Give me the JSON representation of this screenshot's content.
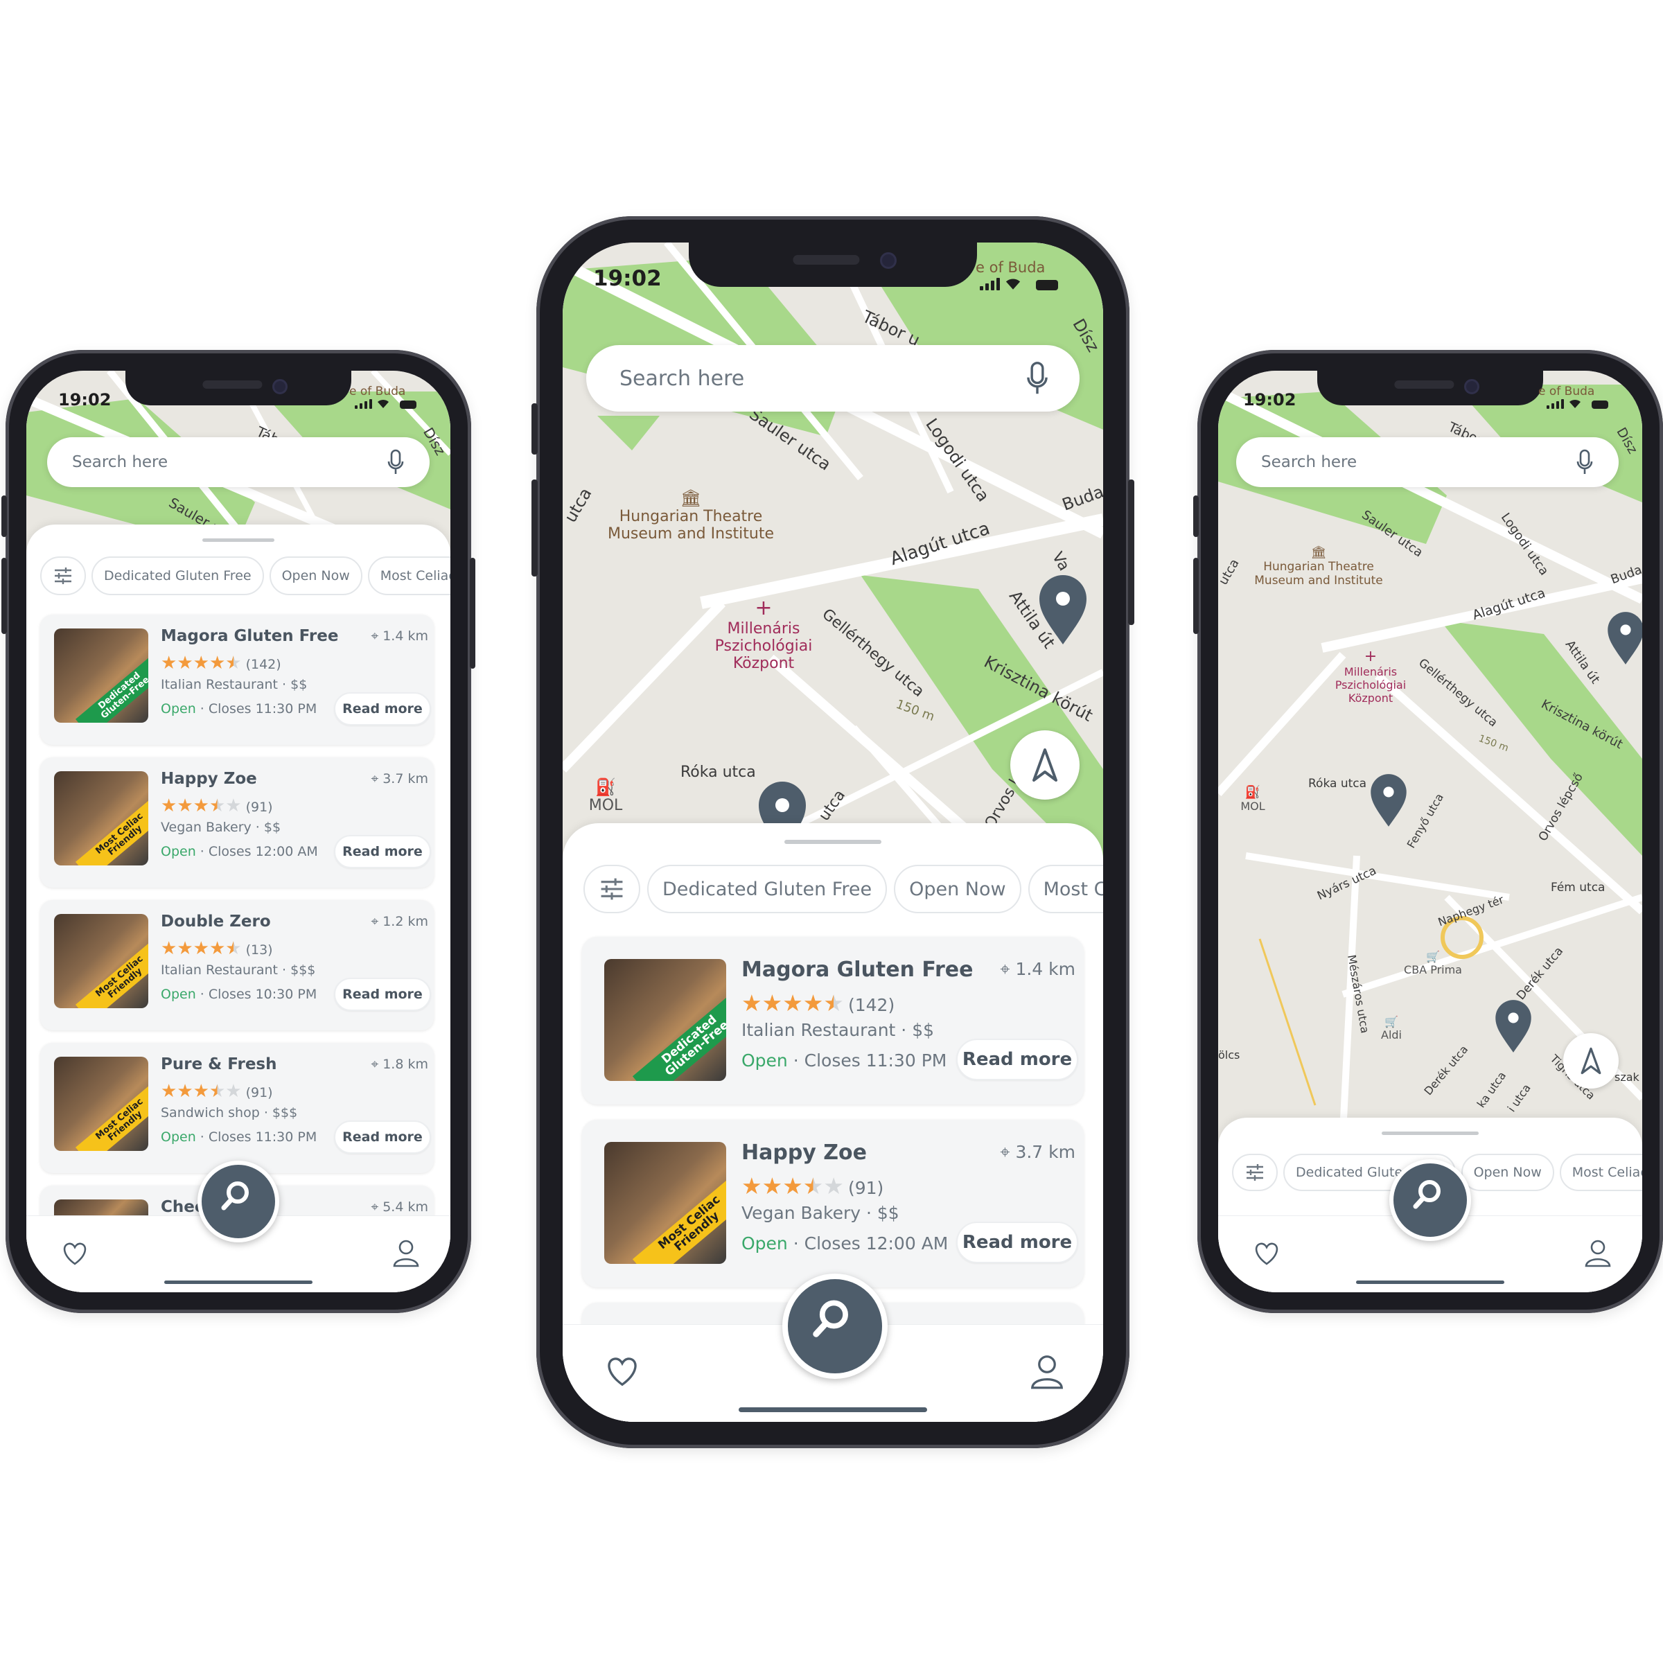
{
  "status": {
    "time": "19:02",
    "map_corner": "e of Buda"
  },
  "search": {
    "placeholder": "Search here"
  },
  "chips": {
    "dedicated": "Dedicated Gluten Free",
    "open_now": "Open Now",
    "most": "Most Celiac Friendly"
  },
  "map_labels": {
    "tabor": "Tábor u",
    "dis": "Dísz",
    "sauler": "Sauler utca",
    "logodi": "Logodi utca",
    "buda": "Buda",
    "utca_left": "utca",
    "theatre": "Hungarian Theatre\nMuseum and Institute",
    "alagut": "Alagút utca",
    "attila": "Attila út",
    "va": "Va",
    "hosp": "Millenáris\nPszichológiai\nKözpont",
    "gellert": "Gellérthegy utca",
    "krisztina": "Krisztina körút",
    "m150": "150 m",
    "mol": "MOL",
    "roka": "Róka utca",
    "orvos": "Orvos lépcső",
    "utca_pin": "utca",
    "fenyo": "Fenyő utca",
    "nyars": "Nyárs utca",
    "naphegy": "Naphegy tér",
    "fem": "Fém utca",
    "cba": "CBA Prima",
    "meszaros": "Mészáros utca",
    "derek": "Derék utca",
    "aldi": "Aldi",
    "tigris": "Tigris utca",
    "szak": "szak",
    "bolcs": "ölcs",
    "kautca": "ka utca",
    "iutca": "i utca",
    "a": "a"
  },
  "restaurants": [
    {
      "name": "Magora Gluten Free",
      "distance": "1.4 km",
      "rating": 4.5,
      "reviews": "(142)",
      "category": "Italian Restaurant · $$",
      "open": "Open",
      "closes": " · Closes 11:30 PM",
      "badge": "Dedicated\nGluten-Free",
      "badge_color": "#1e9a4c",
      "badge_text": "#ffffff"
    },
    {
      "name": "Happy Zoe",
      "distance": "3.7 km",
      "rating": 3.5,
      "reviews": "(91)",
      "category": "Vegan Bakery · $$",
      "open": "Open",
      "closes": " · Closes 12:00 AM",
      "badge": "Most Celiac\nFriendly",
      "badge_color": "#f6c21a",
      "badge_text": "#1e1e1e"
    },
    {
      "name": "Double Zero",
      "distance": "1.2 km",
      "rating": 4.5,
      "reviews": "(13)",
      "category": "Italian Restaurant · $$$",
      "open": "Open",
      "closes": " · Closes 10:30 PM",
      "badge": "Most Celiac\nFriendly",
      "badge_color": "#f6c21a",
      "badge_text": "#1e1e1e"
    },
    {
      "name": "Pure & Fresh",
      "distance": "1.8 km",
      "rating": 3.5,
      "reviews": "(91)",
      "category": "Sandwich shop · $$$",
      "open": "Open",
      "closes": " · Closes 11:30 PM",
      "badge": "Most Celiac\nFriendly",
      "badge_color": "#f6c21a",
      "badge_text": "#1e1e1e"
    },
    {
      "name": "Checkers",
      "distance": "5.4 km"
    }
  ],
  "read_more": "Read more",
  "colors": {
    "accent": "#4e5d6b",
    "star": "#f39a3c",
    "open": "#3aa86a",
    "park": "#a8d88a",
    "road": "#ffffff",
    "map_bg": "#e9e7e1"
  },
  "icons": {
    "search": "magnifier-icon",
    "mic": "microphone-icon",
    "heart": "heart-icon",
    "profile": "user-icon",
    "nav": "navigation-arrow-icon",
    "filter": "sliders-icon",
    "pin": "map-pin-icon"
  }
}
